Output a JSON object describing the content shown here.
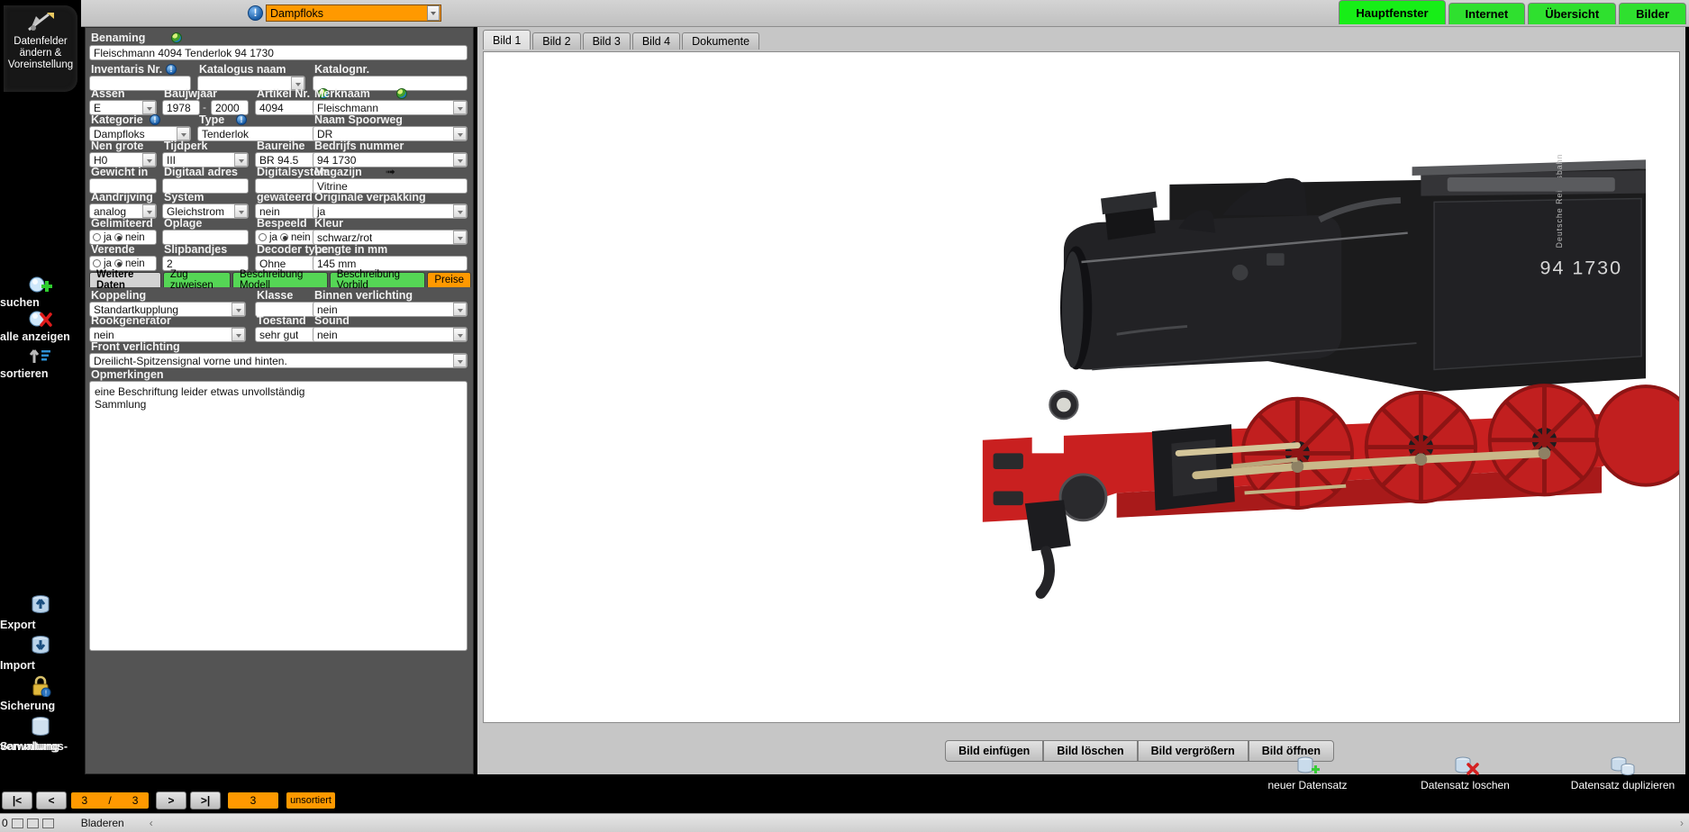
{
  "topbar": {
    "category_value": "Dampfloks",
    "category_icon": "info-icon",
    "tabs": [
      {
        "label": "Hauptfenster",
        "active": true
      },
      {
        "label": "Internet",
        "active": false
      },
      {
        "label": "Übersicht",
        "active": false
      },
      {
        "label": "Bilder",
        "active": false
      }
    ]
  },
  "sidebar": {
    "top_item": {
      "label_line1": "Datenfelder",
      "label_line2": "ändern &",
      "label_line3": "Voreinstellung",
      "icon": "tools-icon"
    },
    "items": [
      {
        "label": "suchen",
        "icon": "search-add-icon"
      },
      {
        "label": "alle anzeigen",
        "icon": "search-clear-icon"
      },
      {
        "label": "sortieren",
        "icon": "sort-ascending-icon"
      },
      {
        "label": "Export",
        "icon": "database-up-icon"
      },
      {
        "label": "Import",
        "icon": "database-down-icon"
      },
      {
        "label": "Sicherung",
        "icon": "lock-icon"
      },
      {
        "label": "Sammlungs-",
        "label2": "verwaltung",
        "icon": "database-icon"
      }
    ]
  },
  "form": {
    "benaming": {
      "label": "Benaming",
      "value": "Fleischmann 4094 Tenderlok 94 1730",
      "icon": "globe-icon"
    },
    "rows": [
      {
        "fields": [
          {
            "label": "Inventaris Nr.",
            "value": "",
            "type": "text",
            "icon": "info-icon"
          },
          {
            "label": "Katalogus naam",
            "value": "",
            "type": "select"
          },
          {
            "label": "Katalognr.",
            "value": "",
            "type": "text"
          }
        ]
      },
      {
        "fields": [
          {
            "label": "Assen",
            "value": "E",
            "type": "select"
          },
          {
            "label": "Baujwjaar",
            "value": "1978",
            "value2": "2000",
            "type": "range"
          },
          {
            "label": "Artikel Nr.",
            "value": "4094",
            "type": "text",
            "icon": "globe-icon"
          },
          {
            "label": "Merknaam",
            "value": "Fleischmann",
            "type": "select",
            "icon": "globe-icon"
          }
        ]
      },
      {
        "fields": [
          {
            "label": "Kategorie",
            "value": "Dampfloks",
            "type": "select",
            "icon": "info-icon"
          },
          {
            "label": "Type",
            "value": "Tenderlok",
            "type": "select",
            "icon": "info-icon"
          },
          {
            "label": "Naam Spoorweg",
            "value": "DR",
            "type": "select"
          }
        ]
      },
      {
        "fields": [
          {
            "label": "Nen grote",
            "value": "H0",
            "type": "select"
          },
          {
            "label": "Tijdperk",
            "value": "III",
            "type": "select"
          },
          {
            "label": "Baureihe",
            "value": "BR 94.5",
            "type": "text"
          },
          {
            "label": "Bedrijfs nummer",
            "value": "94 1730",
            "type": "select"
          }
        ]
      },
      {
        "fields": [
          {
            "label": "Gewicht in",
            "value": "",
            "type": "text"
          },
          {
            "label": "Digitaal adres",
            "value": "",
            "type": "text"
          },
          {
            "label": "Digitalsystem",
            "value": "",
            "type": "select"
          },
          {
            "label": "Magazijn",
            "value": "Vitrine",
            "type": "text",
            "icon": "arrow-icon"
          }
        ]
      },
      {
        "fields": [
          {
            "label": "Aandrijving",
            "value": "analog",
            "type": "select"
          },
          {
            "label": "System",
            "value": "Gleichstrom",
            "type": "select"
          },
          {
            "label": "gewateerd",
            "value": "nein",
            "type": "select"
          },
          {
            "label": "Originale verpakking",
            "value": "ja",
            "type": "select"
          }
        ]
      },
      {
        "fields": [
          {
            "label": "Gelimiteerd",
            "value": "",
            "type": "radio",
            "radio_ja": "ja",
            "radio_nein": "nein",
            "selected": "nein"
          },
          {
            "label": "Oplage",
            "value": "",
            "type": "text"
          },
          {
            "label": "Bespeeld",
            "value": "",
            "type": "radio",
            "radio_ja": "ja",
            "radio_nein": "nein",
            "selected": "nein"
          },
          {
            "label": "Kleur",
            "value": "schwarz/rot",
            "type": "select"
          }
        ]
      },
      {
        "fields": [
          {
            "label": "Verende",
            "value": "",
            "type": "radio",
            "radio_ja": "ja",
            "radio_nein": "nein",
            "selected": "nein"
          },
          {
            "label": "Slipbandjes",
            "value": "2",
            "type": "text"
          },
          {
            "label": "Decoder type",
            "value": "Ohne",
            "type": "select"
          },
          {
            "label": "Lengte in mm",
            "value": "145 mm",
            "type": "text"
          }
        ]
      }
    ],
    "subtabs": [
      {
        "label": "Weitere Daten",
        "style": "active"
      },
      {
        "label": "Zug zuweisen",
        "style": "green"
      },
      {
        "label": "Beschreibung Modell",
        "style": "green"
      },
      {
        "label": "Beschreibung Vorbild",
        "style": "green"
      },
      {
        "label": "Preise",
        "style": "orange"
      }
    ],
    "subrows": [
      {
        "fields": [
          {
            "label": "Koppeling",
            "value": "Standartkupplung",
            "type": "select"
          },
          {
            "label": "Klasse",
            "value": "",
            "type": "select"
          },
          {
            "label": "Binnen verlichting",
            "value": "nein",
            "type": "select"
          }
        ]
      },
      {
        "fields": [
          {
            "label": "Rookgenerator",
            "value": "nein",
            "type": "select"
          },
          {
            "label": "Toestand",
            "value": "sehr gut",
            "type": "select"
          },
          {
            "label": "Sound",
            "value": "nein",
            "type": "select"
          }
        ]
      }
    ],
    "front_verlichting": {
      "label": "Front verlichting",
      "value": "Dreilicht-Spitzensignal vorne und hinten."
    },
    "opmerkingen": {
      "label": "Opmerkingen",
      "line1": "eine Beschriftung leider etwas unvollständig",
      "line2": "Sammlung"
    }
  },
  "image_panel": {
    "tabs": [
      {
        "label": "Bild 1",
        "active": true
      },
      {
        "label": "Bild 2",
        "active": false
      },
      {
        "label": "Bild 3",
        "active": false
      },
      {
        "label": "Bild 4",
        "active": false
      },
      {
        "label": "Dokumente",
        "active": false
      }
    ],
    "buttons": [
      "Bild einfügen",
      "Bild löschen",
      "Bild vergrößern",
      "Bild öffnen"
    ],
    "photo_alt": "BR 94 1730 steam tank locomotive model, black with red wheels"
  },
  "bottom_nav": {
    "first": "|<",
    "prev": "<",
    "counter_current": "3",
    "counter_sep": "/",
    "counter_total": "3",
    "next": ">",
    "last": ">|",
    "count_badge": "3",
    "sort_badge": "unsortiert"
  },
  "right_actions": [
    {
      "label": "neuer Datensatz",
      "icon": "database-add-icon"
    },
    {
      "label": "Datensatz loschen",
      "icon": "database-delete-icon"
    },
    {
      "label": "Datensatz duplizieren",
      "icon": "database-copy-icon"
    }
  ],
  "statusbar": {
    "zoom": "0",
    "browse_label": "Bladeren",
    "chevron": "‹"
  },
  "colors": {
    "accent_orange": "#FF9900",
    "tab_green": "#2FE02F",
    "panel_gray": "#545454"
  }
}
